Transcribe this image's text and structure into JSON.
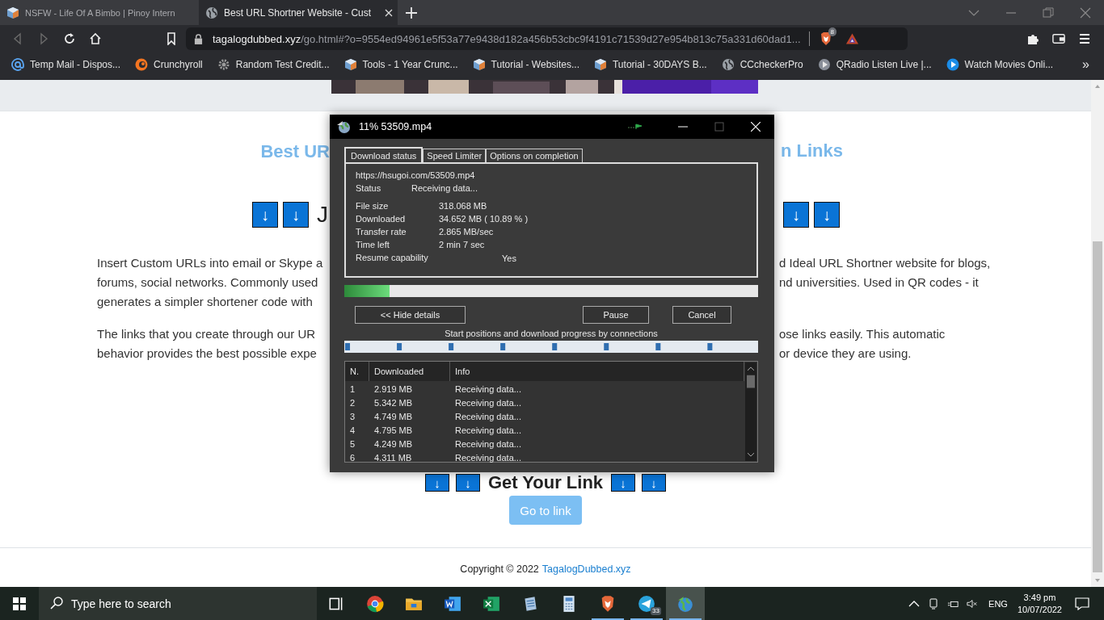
{
  "browser": {
    "tabs": [
      {
        "title": "NSFW - Life Of A Bimbo | Pinoy Intern",
        "selected": false
      },
      {
        "title": "Best URL Shortner Website - Cust",
        "selected": true
      }
    ],
    "address": {
      "host": "tagalogdubbed.xyz",
      "path": "/go.html#?o=9554ed94961e5f53a77e9438d182a456b53cbc9f4191c71539d27e954b813c75a331d60dad1..."
    },
    "shield_count": "8",
    "bookmarks": [
      {
        "kind": "at",
        "label": "Temp Mail - Dispos..."
      },
      {
        "kind": "crunchyroll",
        "label": "Crunchyroll"
      },
      {
        "kind": "gear",
        "label": "Random Test Credit..."
      },
      {
        "kind": "cube",
        "label": "Tools - 1 Year Crunc..."
      },
      {
        "kind": "cube",
        "label": "Tutorial - Websites..."
      },
      {
        "kind": "cube",
        "label": "Tutorial - 30DAYS B..."
      },
      {
        "kind": "globe",
        "label": "CCcheckerPro"
      },
      {
        "kind": "radio",
        "label": "QRadio Listen Live |..."
      },
      {
        "kind": "play",
        "label": "Watch Movies Onli..."
      }
    ],
    "more": "»"
  },
  "page": {
    "heading_left": "Best UR",
    "heading_right": "n Links",
    "arrows_left": [
      "↓",
      "↓"
    ],
    "join_fragment": "J",
    "arrows_right": [
      "↓",
      "↓"
    ],
    "paragraphs": [
      {
        "left": [
          "Insert Custom URLs into email or Skype a",
          "forums, social networks. Commonly used",
          "generates a simpler shortener code with"
        ],
        "right": [
          "d Ideal URL Shortner website for blogs,",
          "nd universities. Used in QR codes - it"
        ]
      },
      {
        "left": [
          "The links that you create through our UR",
          "behavior provides the best possible expe"
        ],
        "right": [
          "ose links easily. This automatic",
          "or device they are using."
        ]
      }
    ],
    "link_heading": {
      "arrows_before": [
        "↓",
        "↓"
      ],
      "text": "Get Your Link",
      "arrows_after": [
        "↓",
        "↓"
      ]
    },
    "go_button": "Go to link",
    "footer": {
      "text": "Copyright © 2022",
      "link": "TagalogDubbed.xyz"
    }
  },
  "download_dialog": {
    "title": "11% 53509.mp4",
    "tabs": [
      {
        "label": "Download status",
        "selected": true
      },
      {
        "label": "Speed Limiter",
        "selected": false
      },
      {
        "label": "Options on completion",
        "selected": false
      }
    ],
    "url": "https://hsugoi.com/53509.mp4",
    "status": {
      "label": "Status",
      "value": "Receiving data..."
    },
    "details": [
      {
        "kind": "value",
        "label": "File size",
        "value": "318.068  MB"
      },
      {
        "kind": "value",
        "label": "Downloaded",
        "value": "34.652  MB  ( 10.89 % )"
      },
      {
        "kind": "value",
        "label": "Transfer rate",
        "value": "2.865  MB/sec"
      },
      {
        "kind": "value",
        "label": "Time left",
        "value": "2 min 7 sec"
      },
      {
        "kind": "flag",
        "label": "Resume capability",
        "value": "Yes"
      }
    ],
    "progress": {
      "level": 0.11
    },
    "buttons": {
      "hide": "<< Hide details",
      "pause": "Pause",
      "cancel": "Cancel"
    },
    "connections_label": "Start positions and download progress by connections",
    "table": {
      "columns": [
        "N.",
        "Downloaded",
        "Info"
      ],
      "rows": [
        {
          "n": "1",
          "downloaded": "2.919  MB",
          "info": "Receiving data..."
        },
        {
          "n": "2",
          "downloaded": "5.342  MB",
          "info": "Receiving data..."
        },
        {
          "n": "3",
          "downloaded": "4.749  MB",
          "info": "Receiving data..."
        },
        {
          "n": "4",
          "downloaded": "4.795  MB",
          "info": "Receiving data..."
        },
        {
          "n": "5",
          "downloaded": "4.249  MB",
          "info": "Receiving data..."
        },
        {
          "n": "6",
          "downloaded": "4.311  MB",
          "info": "Receiving data..."
        }
      ]
    }
  },
  "taskbar": {
    "search_placeholder": "Type here to search",
    "apps": [
      {
        "kind": "taskview",
        "running": false,
        "selected": false
      },
      {
        "kind": "chrome",
        "running": false,
        "selected": false
      },
      {
        "kind": "folder",
        "running": false,
        "selected": false
      },
      {
        "kind": "word",
        "running": false,
        "selected": false
      },
      {
        "kind": "excel",
        "running": false,
        "selected": false
      },
      {
        "kind": "notepad",
        "running": false,
        "selected": false
      },
      {
        "kind": "calculator",
        "running": false,
        "selected": false
      },
      {
        "kind": "brave",
        "running": true,
        "selected": false
      },
      {
        "kind": "telegram",
        "running": true,
        "selected": false,
        "badge": "33"
      },
      {
        "kind": "globe",
        "running": true,
        "selected": true
      }
    ],
    "language": "ENG",
    "time": "3:49 pm",
    "date": "10/07/2022"
  }
}
